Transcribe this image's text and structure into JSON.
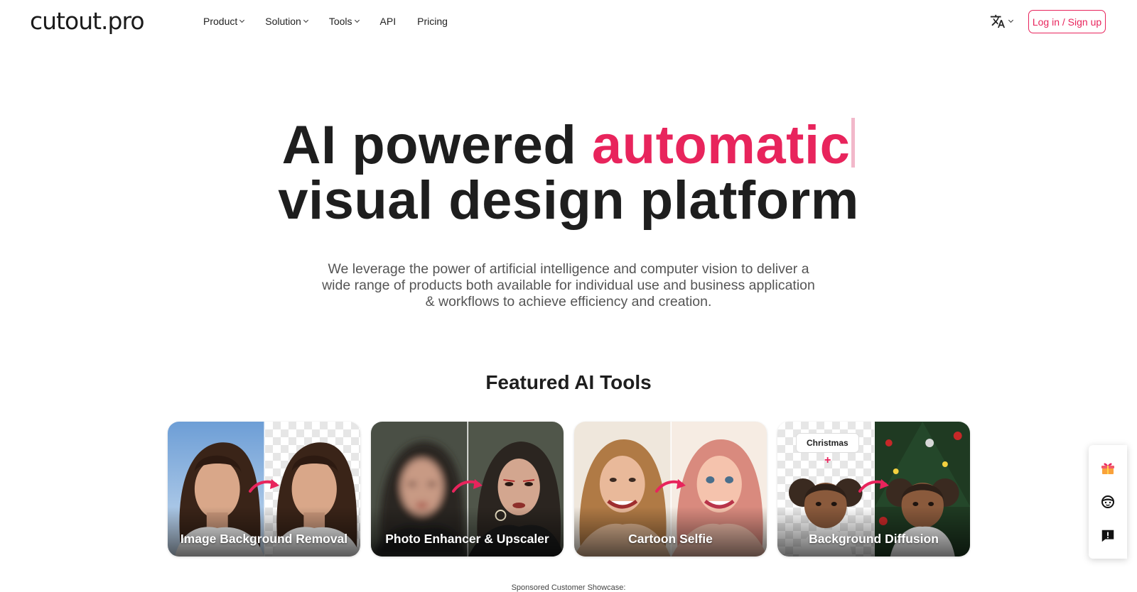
{
  "header": {
    "logo": "cutout.pro",
    "nav": [
      {
        "label": "Product",
        "dropdown": true
      },
      {
        "label": "Solution",
        "dropdown": true
      },
      {
        "label": "Tools",
        "dropdown": true
      },
      {
        "label": "API",
        "dropdown": false
      },
      {
        "label": "Pricing",
        "dropdown": false
      }
    ],
    "language_icon": "translate-icon",
    "login_label": "Log in / Sign up"
  },
  "hero": {
    "title_part1": "AI powered ",
    "title_accent": "automatic",
    "title_line2": "visual design platform",
    "subtitle": "We leverage the power of artificial intelligence and computer vision to deliver a wide range of products both available for individual use and business application & workflows to achieve efficiency and creation."
  },
  "featured": {
    "title": "Featured AI Tools",
    "cards": [
      {
        "label": "Image Background Removal"
      },
      {
        "label": "Photo Enhancer & Upscaler"
      },
      {
        "label": "Cartoon Selfie"
      },
      {
        "label": "Background Diffusion",
        "tag": "Christmas",
        "plus": "+"
      }
    ]
  },
  "sponsored": "Sponsored Customer Showcase:",
  "side_panel": {
    "items": [
      "gift-icon",
      "support-agent-icon",
      "feedback-icon"
    ]
  },
  "colors": {
    "accent": "#e8245c",
    "text": "#1e1e1e",
    "muted": "#555555"
  }
}
